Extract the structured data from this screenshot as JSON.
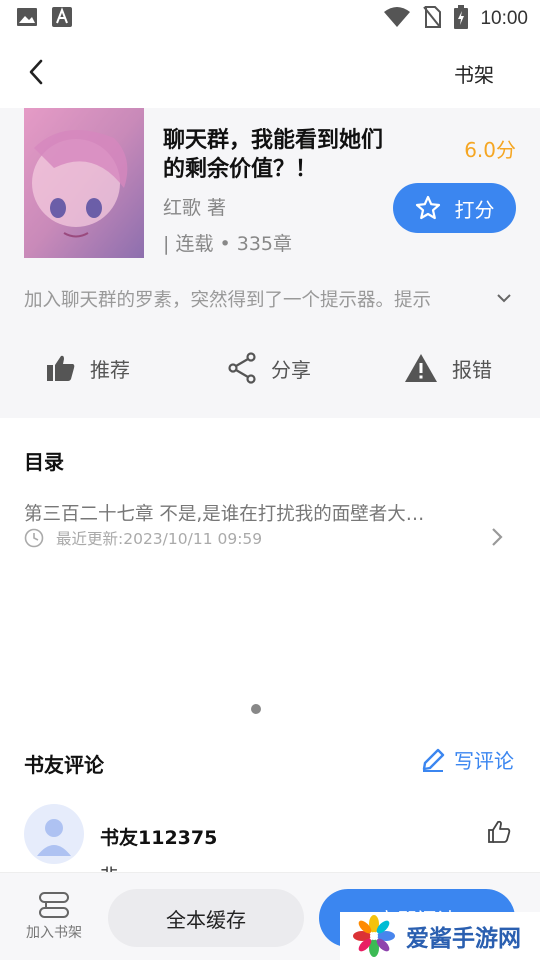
{
  "status_bar": {
    "time": "10:00",
    "icons": [
      "image-icon",
      "font-icon",
      "wifi-icon",
      "no-sim-icon",
      "battery-charging-icon"
    ]
  },
  "topbar": {
    "back_icon": "chevron-left-icon",
    "shelf_label": "书架"
  },
  "book": {
    "title": "聊天群，我能看到她们的剩余价值？！",
    "score": "6.0分",
    "author": "红歌 著",
    "meta": "| 连载 • 335章",
    "rate_label": "打分",
    "intro": "加入聊天群的罗素，突然得到了一个提示器。提示"
  },
  "actions": [
    {
      "label": "推荐",
      "icon": "thumbs-up-icon"
    },
    {
      "label": "分享",
      "icon": "share-icon"
    },
    {
      "label": "报错",
      "icon": "warning-icon"
    }
  ],
  "toc": {
    "title": "目录",
    "latest_chapter": "第三百二十七章 不是,是谁在打扰我的面壁者大…",
    "updated": "最近更新:2023/10/11 09:59"
  },
  "comments": {
    "title": "书友评论",
    "write_label": "写评论",
    "items": [
      {
        "user": "书友112375",
        "text": "非"
      }
    ]
  },
  "bottom_bar": {
    "add_shelf_label": "加入书架",
    "cache_label": "全本缓存",
    "read_label": "立即阅读"
  },
  "watermark": {
    "text": "爱酱手游网"
  },
  "colors": {
    "accent": "#3b86f0",
    "score": "#f5a623",
    "card_bg": "#f6f6f8"
  }
}
